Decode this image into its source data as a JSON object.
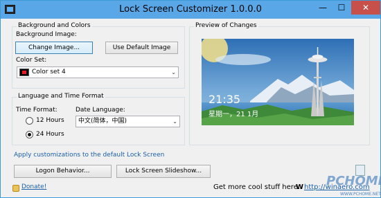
{
  "window": {
    "title": "Lock Screen Customizer 1.0.0.0",
    "minimize_glyph": "—",
    "maximize_glyph": "☐",
    "close_glyph": "✕"
  },
  "background_group": {
    "legend": "Background and Colors",
    "bg_image_label": "Background Image:",
    "change_image_button": "Change Image...",
    "default_image_button": "Use Default Image",
    "color_set_label": "Color Set:",
    "color_set_value": "Color set 4"
  },
  "language_group": {
    "legend": "Language and Time Format",
    "time_format_label": "Time Format:",
    "option_12": "12 Hours",
    "option_24": "24 Hours",
    "selected_time_format": "24 Hours",
    "date_language_label": "Date Language:",
    "date_language_value": "中文(简体，中国)"
  },
  "preview_group": {
    "legend": "Preview of Changes",
    "time": "21:35",
    "date": "星期一，21 1月"
  },
  "apply_link": "Apply customizations to the default Lock Screen",
  "buttons": {
    "logon": "Logon Behavior...",
    "slideshow": "Lock Screen Slideshow..."
  },
  "footer": {
    "donate": "Donate!",
    "more_stuff": "Get more cool stuff here:",
    "site_link": "http://winaero.com"
  },
  "watermark": {
    "brand": "PCHOME",
    "site": "WWW.PCHOME.NET"
  },
  "colors": {
    "titlebar": "#5aa7e8",
    "close": "#c7504a",
    "link": "#1a5fa8"
  }
}
